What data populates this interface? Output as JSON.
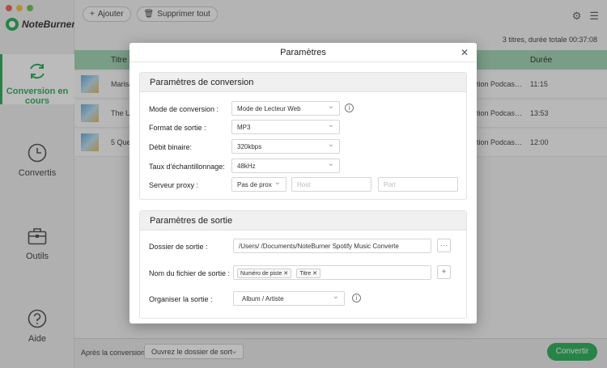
{
  "app": {
    "name": "NoteBurner"
  },
  "sidebar": {
    "items": [
      {
        "label": "Conversion en cours",
        "icon": "refresh-icon"
      },
      {
        "label": "Convertis",
        "icon": "clock-icon"
      },
      {
        "label": "Outils",
        "icon": "toolbox-icon"
      },
      {
        "label": "Aide",
        "icon": "help-icon"
      }
    ]
  },
  "toolbar": {
    "add_label": "Ajouter",
    "delete_all_label": "Supprimer tout"
  },
  "summary": "3 titres, durée totale 00:37:08",
  "table": {
    "headers": {
      "title": "Titre",
      "duration": "Durée"
    },
    "rows": [
      {
        "title": "Marisa",
        "album": "ation Podcas…",
        "duration": "11:15"
      },
      {
        "title": "The Ur",
        "album": "ation Podcas…",
        "duration": "13:53"
      },
      {
        "title": "5 Ques",
        "album": "ation Podcas…",
        "duration": "12:00"
      }
    ]
  },
  "footer": {
    "after_label": "Après la conversion :",
    "after_value": "Ouvrez le dossier de sort",
    "convert_label": "Convertir"
  },
  "modal": {
    "title": "Paramètres",
    "conversion": {
      "heading": "Paramètres de conversion",
      "mode_label": "Mode de conversion :",
      "mode_value": "Mode de Lecteur Web",
      "format_label": "Format de sortie :",
      "format_value": "MP3",
      "bitrate_label": "Débit binaire:",
      "bitrate_value": "320kbps",
      "samplerate_label": "Taux d'échantillonnage:",
      "samplerate_value": "48kHz",
      "proxy_label": "Serveur proxy :",
      "proxy_value": "Pas de prox",
      "host_placeholder": "Host",
      "port_placeholder": "Port"
    },
    "output": {
      "heading": "Paramètres de sortie",
      "folder_label": "Dossier de sortie :",
      "folder_value": "/Users/        /Documents/NoteBurner Spotify Music Converte",
      "folder_btn": "···",
      "filename_label": "Nom du fichier de sortie :",
      "filename_chips": [
        "Numéro de piste",
        "Titre"
      ],
      "add_btn": "+",
      "organize_label": "Organiser la sortie :",
      "organize_value": "Album / Artiste"
    }
  },
  "colors": {
    "accent": "#1ea94e",
    "header_green": "#9bd2b0"
  }
}
